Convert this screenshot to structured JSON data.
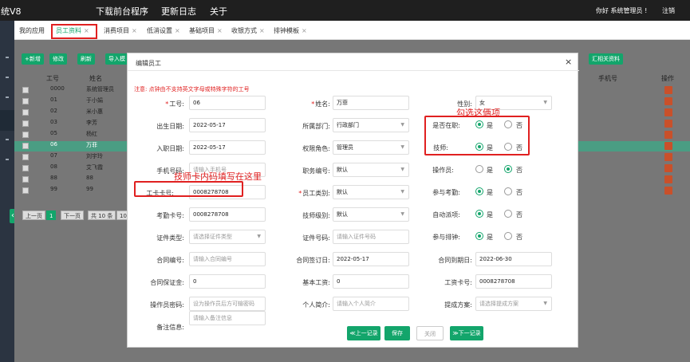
{
  "topbar": {
    "app_title": "统V8",
    "nav": [
      "下载前台程序",
      "更新日志",
      "关于"
    ],
    "greeting": "你好 系统管理员 !",
    "logout": "注销"
  },
  "tabs": [
    {
      "label": "我的应用"
    },
    {
      "label": "员工资料"
    },
    {
      "label": "消费项目"
    },
    {
      "label": "低消设置"
    },
    {
      "label": "基础项目"
    },
    {
      "label": "收银方式"
    },
    {
      "label": "排钟模板"
    }
  ],
  "background": {
    "toolbar": [
      "+新增",
      "修改",
      "刷新",
      "导入模",
      "汇相关资料"
    ],
    "headers": [
      "工号",
      "姓名",
      "手机号",
      "操作"
    ],
    "rows": [
      {
        "id": "0000",
        "name": "系统管理员"
      },
      {
        "id": "01",
        "name": "于小娟"
      },
      {
        "id": "02",
        "name": "米小惠"
      },
      {
        "id": "03",
        "name": "李芳"
      },
      {
        "id": "05",
        "name": "杨红"
      },
      {
        "id": "06",
        "name": "万菲"
      },
      {
        "id": "07",
        "name": "刘宇玲"
      },
      {
        "id": "08",
        "name": "艾飞霞"
      },
      {
        "id": "88",
        "name": "88"
      },
      {
        "id": "99",
        "name": "99"
      }
    ],
    "pager": {
      "prev": "上一页",
      "current": "1",
      "next": "下一页",
      "total": "共 10 条",
      "size": "10"
    }
  },
  "dialog": {
    "title": "编辑员工",
    "note": "注意: 点钟由不支持英文字母或特殊字符的工号",
    "fields": {
      "emp_no": {
        "label": "工号:",
        "value": "06"
      },
      "name": {
        "label": "姓名:",
        "value": "万菲"
      },
      "gender": {
        "label": "性别:",
        "value": "女"
      },
      "birth": {
        "label": "出生日期:",
        "value": "2022-05-17"
      },
      "dept": {
        "label": "所属部门:",
        "value": "行政部门"
      },
      "in_service": {
        "label": "是否在职:",
        "yes": "是",
        "no": "否"
      },
      "entry_date": {
        "label": "入职日期:",
        "value": "2022-05-17"
      },
      "role": {
        "label": "权限角色:",
        "value": "管理员"
      },
      "technician": {
        "label": "技师:",
        "yes": "是",
        "no": "否"
      },
      "phone": {
        "label": "手机号码:",
        "placeholder": "请输入手机号"
      },
      "position": {
        "label": "职务编号:",
        "value": "默认"
      },
      "operator": {
        "label": "操作员:",
        "yes": "是",
        "no": "否"
      },
      "card": {
        "label": "工卡卡号:",
        "value": "0008278708"
      },
      "category": {
        "label": "员工类别:",
        "value": "默认"
      },
      "attendance": {
        "label": "参与考勤:",
        "yes": "是",
        "no": "否"
      },
      "att_card": {
        "label": "考勤卡号:",
        "value": "0008278708"
      },
      "tech_level": {
        "label": "技师级别:",
        "value": "默认"
      },
      "auto_dispatch": {
        "label": "自动派项:",
        "yes": "是",
        "no": "否"
      },
      "id_type": {
        "label": "证件类型:",
        "placeholder": "请选择证件类型"
      },
      "id_no": {
        "label": "证件号码:",
        "placeholder": "请输入证件号码"
      },
      "schedule": {
        "label": "参与排钟:",
        "yes": "是",
        "no": "否"
      },
      "contract_no": {
        "label": "合同编号:",
        "placeholder": "请输入合同编号"
      },
      "contract_date": {
        "label": "合同签订日:",
        "value": "2022-05-17"
      },
      "contract_end": {
        "label": "合同到期日:",
        "value": "2022-06-30"
      },
      "deposit": {
        "label": "合同保证金:",
        "value": "0"
      },
      "salary": {
        "label": "基本工资:",
        "value": "0"
      },
      "salary_card": {
        "label": "工资卡号:",
        "value": "0008278708"
      },
      "op_password": {
        "label": "操作员密码:",
        "placeholder": "设为操作员后方可输密码"
      },
      "intro": {
        "label": "个人简介:",
        "placeholder": "请输入个人简介"
      },
      "commission": {
        "label": "提成方案:",
        "placeholder": "请选择提成方案"
      },
      "remark": {
        "label": "备注信息:",
        "placeholder": "请输入备注信息"
      }
    },
    "buttons": {
      "prev": "≪上一记录",
      "save": "保存",
      "close": "关闭",
      "next": "≫下一记录"
    }
  },
  "annotations": {
    "check_both": "勾选这俩项",
    "card_hint": "技师卡内码填写在这里"
  }
}
